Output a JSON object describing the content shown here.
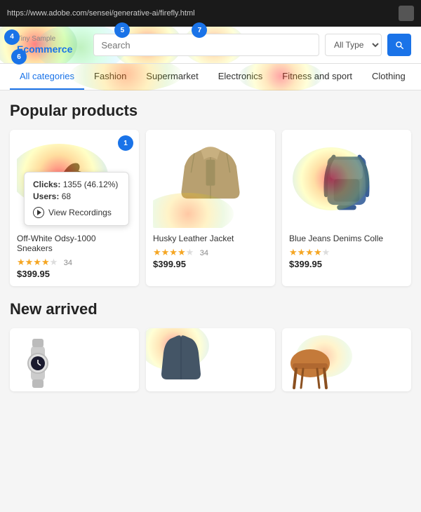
{
  "browser": {
    "url": "https://www.adobe.com/sensei/generative-ai/firefly.html",
    "button_label": ""
  },
  "header": {
    "logo_small": "Tiny Sample",
    "logo_brand": "Ecommerce",
    "bubbles": [
      {
        "id": "b4",
        "number": "4",
        "position": "logo"
      },
      {
        "id": "b5",
        "number": "5",
        "position": "search"
      },
      {
        "id": "b6",
        "number": "6",
        "position": "logo-below"
      },
      {
        "id": "b7",
        "number": "7",
        "position": "mid"
      }
    ],
    "search_placeholder": "Search",
    "type_options": [
      "All Type"
    ],
    "search_icon": "search"
  },
  "nav": {
    "items": [
      {
        "label": "All categories",
        "active": true
      },
      {
        "label": "Fashion",
        "active": false
      },
      {
        "label": "Supermarket",
        "active": false
      },
      {
        "label": "Electronics",
        "active": false
      },
      {
        "label": "Fitness and sport",
        "active": false
      },
      {
        "label": "Clothing",
        "active": false
      }
    ]
  },
  "popular_products": {
    "title": "Popular products",
    "products": [
      {
        "name": "Off-White Odsy-1000 Sneakers",
        "price": "$399.95",
        "stars": 4,
        "review_count": "34",
        "bubble_number": "1",
        "tooltip": {
          "clicks": "1355 (46.12%)",
          "users": "68",
          "view_recordings_label": "View Recordings"
        }
      },
      {
        "name": "Husky Leather Jacket",
        "price": "$399.95",
        "stars": 4,
        "review_count": "34",
        "bubble_number": null
      },
      {
        "name": "Blue Jeans Denims Colle",
        "price": "$399.95",
        "stars": 4,
        "review_count": "34",
        "bubble_number": null
      }
    ]
  },
  "new_arrived": {
    "title": "New arrived",
    "items": [
      {
        "label": "Watch"
      },
      {
        "label": "Jacket"
      },
      {
        "label": "Item"
      }
    ]
  },
  "tooltip": {
    "clicks_label": "Clicks:",
    "clicks_value": "1355 (46.12%)",
    "users_label": "Users:",
    "users_value": "68",
    "view_recordings": "View Recordings"
  }
}
